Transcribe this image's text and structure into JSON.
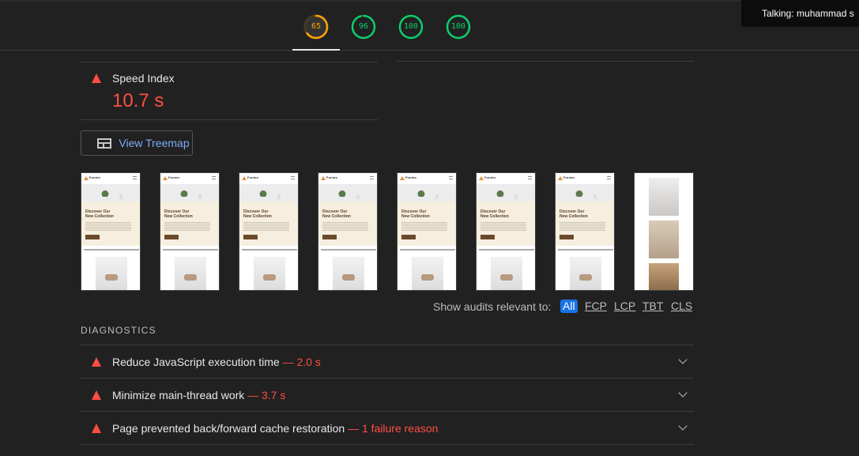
{
  "scores": [
    {
      "value": "65",
      "fraction": 0.65,
      "color": "#ffa400"
    },
    {
      "value": "96",
      "fraction": 0.96,
      "color": "#0cce6b"
    },
    {
      "value": "100",
      "fraction": 1.0,
      "color": "#0cce6b"
    },
    {
      "value": "100",
      "fraction": 1.0,
      "color": "#0cce6b"
    }
  ],
  "tooltip": "Talking: muhammad s",
  "metric": {
    "title": "Speed Index",
    "value": "10.7 s",
    "status_color": "#ff4e42"
  },
  "treemap_button": "View Treemap",
  "filmstrip": {
    "brand": "Furniro",
    "hero_line1": "Discover Our",
    "hero_line2": "New Collection"
  },
  "filter": {
    "label": "Show audits relevant to:",
    "options": [
      "All",
      "FCP",
      "LCP",
      "TBT",
      "CLS"
    ],
    "selected": "All"
  },
  "diagnostics": {
    "title": "DIAGNOSTICS",
    "items": [
      {
        "title": "Reduce JavaScript execution time",
        "display": "— 2.0 s"
      },
      {
        "title": "Minimize main-thread work",
        "display": "— 3.7 s"
      },
      {
        "title": "Page prevented back/forward cache restoration",
        "display": "— 1 failure reason"
      }
    ]
  }
}
